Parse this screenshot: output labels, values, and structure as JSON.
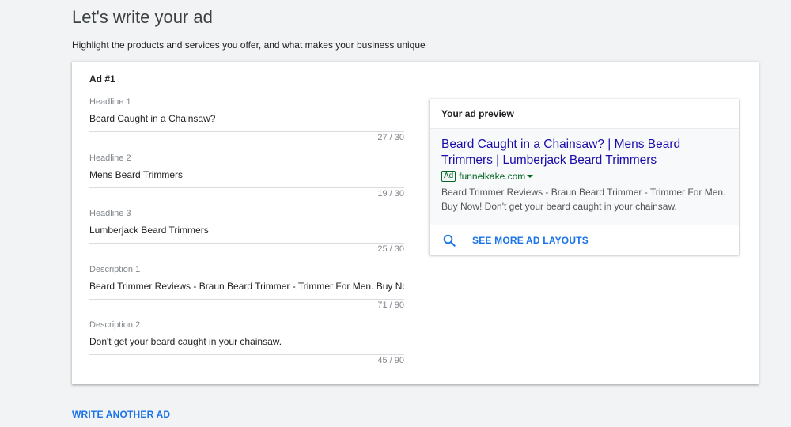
{
  "header": {
    "title": "Let's write your ad",
    "subtitle": "Highlight the products and services you offer, and what makes your business unique"
  },
  "ad": {
    "title": "Ad #1",
    "fields": [
      {
        "label": "Headline 1",
        "value": "Beard Caught in a Chainsaw?",
        "count": "27 / 30"
      },
      {
        "label": "Headline 2",
        "value": "Mens Beard Trimmers",
        "count": "19 / 30"
      },
      {
        "label": "Headline 3",
        "value": "Lumberjack Beard Trimmers",
        "count": "25 / 30"
      },
      {
        "label": "Description 1",
        "value": "Beard Trimmer Reviews - Braun Beard Trimmer - Trimmer For Men. Buy Now!",
        "count": "71 / 90"
      },
      {
        "label": "Description 2",
        "value": "Don't get your beard caught in your chainsaw.",
        "count": "45 / 90"
      }
    ]
  },
  "preview": {
    "title": "Your ad preview",
    "headline": "Beard Caught in a Chainsaw? | Mens Beard Trimmers | Lumberjack Beard Trimmers",
    "badge": "Ad",
    "url": "funnelkake.com",
    "description": "Beard Trimmer Reviews - Braun Beard Trimmer - Trimmer For Men. Buy Now! Don't get your beard caught in your chainsaw.",
    "see_more_label": "SEE MORE AD LAYOUTS",
    "see_more_icon": "search-icon"
  },
  "actions": {
    "write_another_label": "WRITE ANOTHER AD"
  },
  "colors": {
    "accent": "#1a73e8",
    "ad_headline": "#1a0dab",
    "ad_url": "#006621",
    "background": "#f1f3f4"
  }
}
